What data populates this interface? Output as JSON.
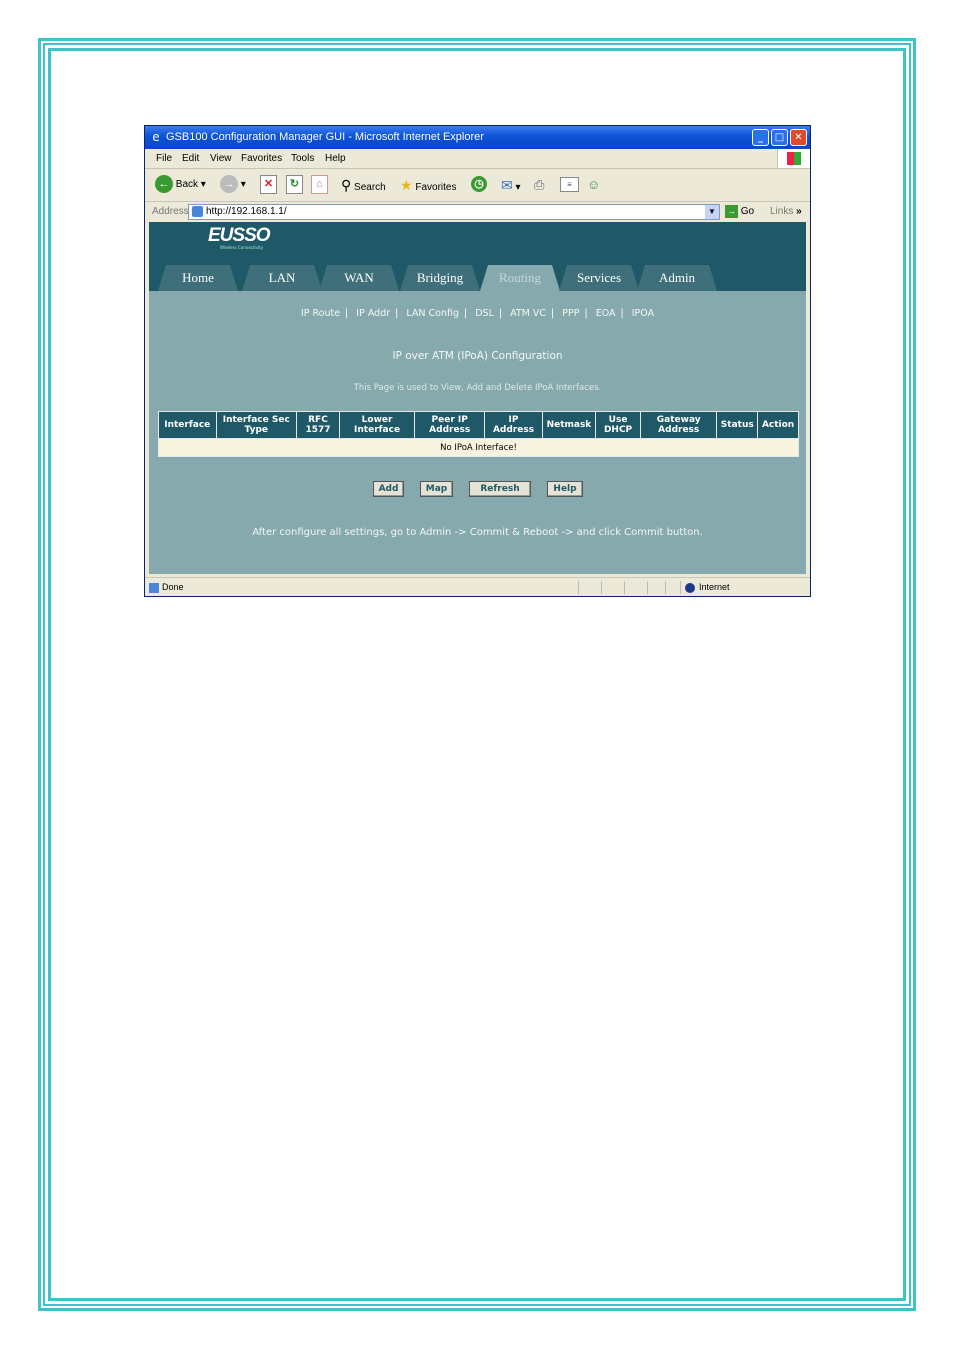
{
  "browser": {
    "title": "GSB100 Configuration Manager GUI - Microsoft Internet Explorer",
    "menu": [
      "File",
      "Edit",
      "View",
      "Favorites",
      "Tools",
      "Help"
    ],
    "toolbar": {
      "back": "Back",
      "search": "Search",
      "favorites": "Favorites"
    },
    "address_label": "Address",
    "url": "http://192.168.1.1/",
    "go": "Go",
    "links": "Links",
    "status_text": "Done",
    "zone": "Internet"
  },
  "router": {
    "logo": "EUSSO",
    "logo_sub": "Wireless Connectivity",
    "tabs": [
      "Home",
      "LAN",
      "WAN",
      "Bridging",
      "Routing",
      "Services",
      "Admin"
    ],
    "active_tab": "Routing",
    "subnav": [
      "IP Route",
      "IP Addr",
      "LAN Config",
      "DSL",
      "ATM VC",
      "PPP",
      "EOA",
      "IPOA"
    ],
    "page_title": "IP over ATM (IPoA) Configuration",
    "description": "This Page is used to View, Add and Delete IPoA Interfaces.",
    "table": {
      "headers": [
        "Interface",
        "Interface Sec Type",
        "RFC 1577",
        "Lower Interface",
        "Peer IP Address",
        "IP Address",
        "Netmask",
        "Use DHCP",
        "Gateway Address",
        "Status",
        "Action"
      ],
      "empty_message": "No IPoA Interface!"
    },
    "buttons": {
      "add": "Add",
      "map": "Map",
      "refresh": "Refresh",
      "help": "Help"
    },
    "note": "After configure all settings, go to Admin -> Commit & Reboot -> and click Commit button."
  }
}
